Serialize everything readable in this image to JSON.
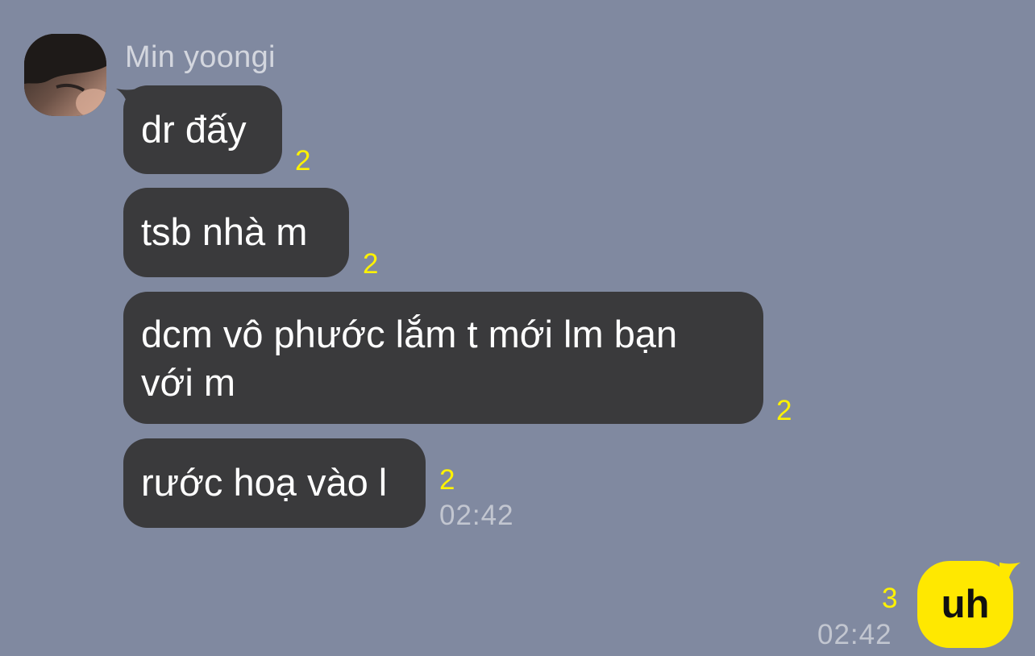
{
  "conversation": {
    "contact": {
      "name": "Min yoongi"
    },
    "received": [
      {
        "text": "dr đấy",
        "read_count": "2"
      },
      {
        "text": "tsb nhà m",
        "read_count": "2"
      },
      {
        "text": "dcm vô phước lắm t mới lm bạn với m",
        "read_count": "2"
      },
      {
        "text": "rước hoạ vào l",
        "read_count": "2",
        "time": "02:42"
      }
    ],
    "sent": [
      {
        "text": "uh",
        "read_count": "3",
        "time": "02:42"
      }
    ]
  },
  "colors": {
    "background": "#8089a0",
    "received_bubble": "#3a3a3c",
    "sent_bubble": "#ffe800",
    "read_count": "#fff200"
  }
}
